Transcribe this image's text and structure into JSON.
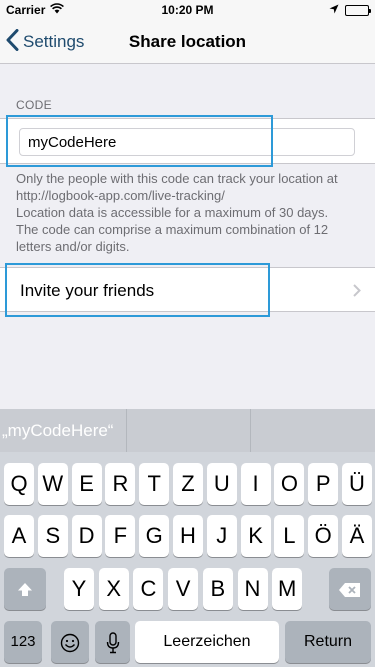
{
  "status_bar": {
    "carrier": "Carrier",
    "time": "10:20 PM",
    "icons": [
      "wifi-icon",
      "location-arrow-icon",
      "battery-icon"
    ]
  },
  "nav": {
    "back_label": "Settings",
    "title": "Share location"
  },
  "code_section": {
    "header": "CODE",
    "input_value": "myCodeHere",
    "footer_lines": [
      "Only the people with this code can track your location at",
      "http://logbook-app.com/live-tracking/",
      "Location data is accessible for a maximum of 30 days.",
      "The code can comprise a maximum combination of 12",
      "letters and/or digits."
    ]
  },
  "invite": {
    "label": "Invite your friends"
  },
  "keyboard": {
    "predictions": [
      "„myCodeHere“",
      "",
      ""
    ],
    "row1": [
      "Q",
      "W",
      "E",
      "R",
      "T",
      "Z",
      "U",
      "I",
      "O",
      "P",
      "Ü"
    ],
    "row2": [
      "A",
      "S",
      "D",
      "F",
      "G",
      "H",
      "J",
      "K",
      "L",
      "Ö",
      "Ä"
    ],
    "row3": [
      "Y",
      "X",
      "C",
      "V",
      "B",
      "N",
      "M"
    ],
    "numbers_label": "123",
    "space_label": "Leerzeichen",
    "return_label": "Return"
  },
  "colors": {
    "accent": "#1f4b6e",
    "highlight": "#2d9ad8",
    "background": "#efeff4"
  }
}
